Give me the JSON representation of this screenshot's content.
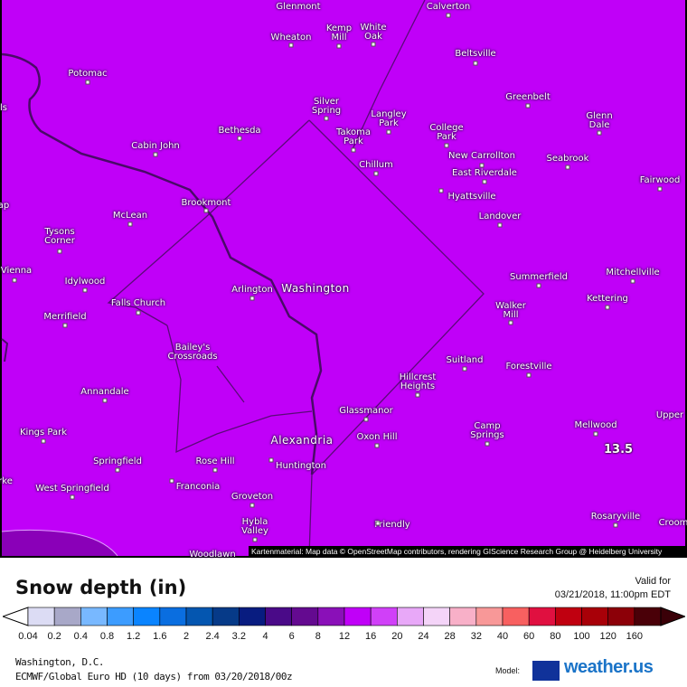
{
  "map": {
    "fill_color": "#c000f8",
    "low_region_color": "#8a00b8",
    "value_label": "13.5",
    "attribution": "Kartenmaterial: Map data © OpenStreetMap contributors, rendering GIScience Research Group @ Heidelberg University",
    "cities": [
      "Glenmont",
      "Wheaton",
      "Kemp\nMill",
      "White\nOak",
      "Calverton",
      "Beltsville",
      "Potomac",
      "Greenbelt",
      "Silver\nSpring",
      "Langley\nPark",
      "Glenn\nDale",
      "ls",
      "Cabin John",
      "Bethesda",
      "Takoma\nPark",
      "College\nPark",
      "New Carrollton",
      "Seabrook",
      "Chillum",
      "East Riverdale",
      "Fairwood",
      "Brookmont",
      "Hyattsville",
      "ap",
      "McLean",
      "Landover",
      "Tysons\nCorner",
      "Vienna",
      "Summerfield",
      "Mitchellville",
      "Idylwood",
      "Arlington",
      "Washington",
      "Falls Church",
      "Kettering",
      "Walker\nMill",
      "Merrifield",
      "Bailey's\nCrossroads",
      "Suitland",
      "Forestville",
      "Hillcrest\nHeights",
      "Annandale",
      "Glassmanor",
      "Upper",
      "Camp\nSprings",
      "Mellwood",
      "Kings Park",
      "Oxon Hill",
      "Alexandria",
      "Springfield",
      "Rose Hill",
      "Huntington",
      "rke",
      "Franconia",
      "West Springfield",
      "Groveton",
      "Hybla\nValley",
      "Friendly",
      "Rosaryville",
      "Croom",
      "Woodlawn"
    ]
  },
  "legend": {
    "title": "Snow depth (in)",
    "valid_label": "Valid for",
    "valid_time": "03/21/2018, 11:00pm EDT",
    "ticks": [
      "0.04",
      "0.2",
      "0.4",
      "0.8",
      "1.2",
      "1.6",
      "2",
      "2.4",
      "3.2",
      "4",
      "6",
      "8",
      "12",
      "16",
      "20",
      "24",
      "28",
      "32",
      "40",
      "60",
      "80",
      "100",
      "120",
      "160"
    ],
    "colors": [
      "#dcdcf4",
      "#a8a8c8",
      "#78b8ff",
      "#3c9cff",
      "#0a84ff",
      "#0a6ee0",
      "#0456b0",
      "#063a88",
      "#081c80",
      "#4a0a88",
      "#640a90",
      "#8a10b8",
      "#c000f8",
      "#d040f8",
      "#e8a8f8",
      "#f4d4f8",
      "#f8b0c8",
      "#f89898",
      "#f86060",
      "#e01040",
      "#c00010",
      "#a80008",
      "#8c0008",
      "#4a0008"
    ]
  },
  "footer": {
    "location": "Washington, D.C.",
    "model_run": "ECMWF/Global Euro HD (10 days) from 03/20/2018/00z",
    "model_label": "Model:",
    "brand": "weather.us"
  }
}
